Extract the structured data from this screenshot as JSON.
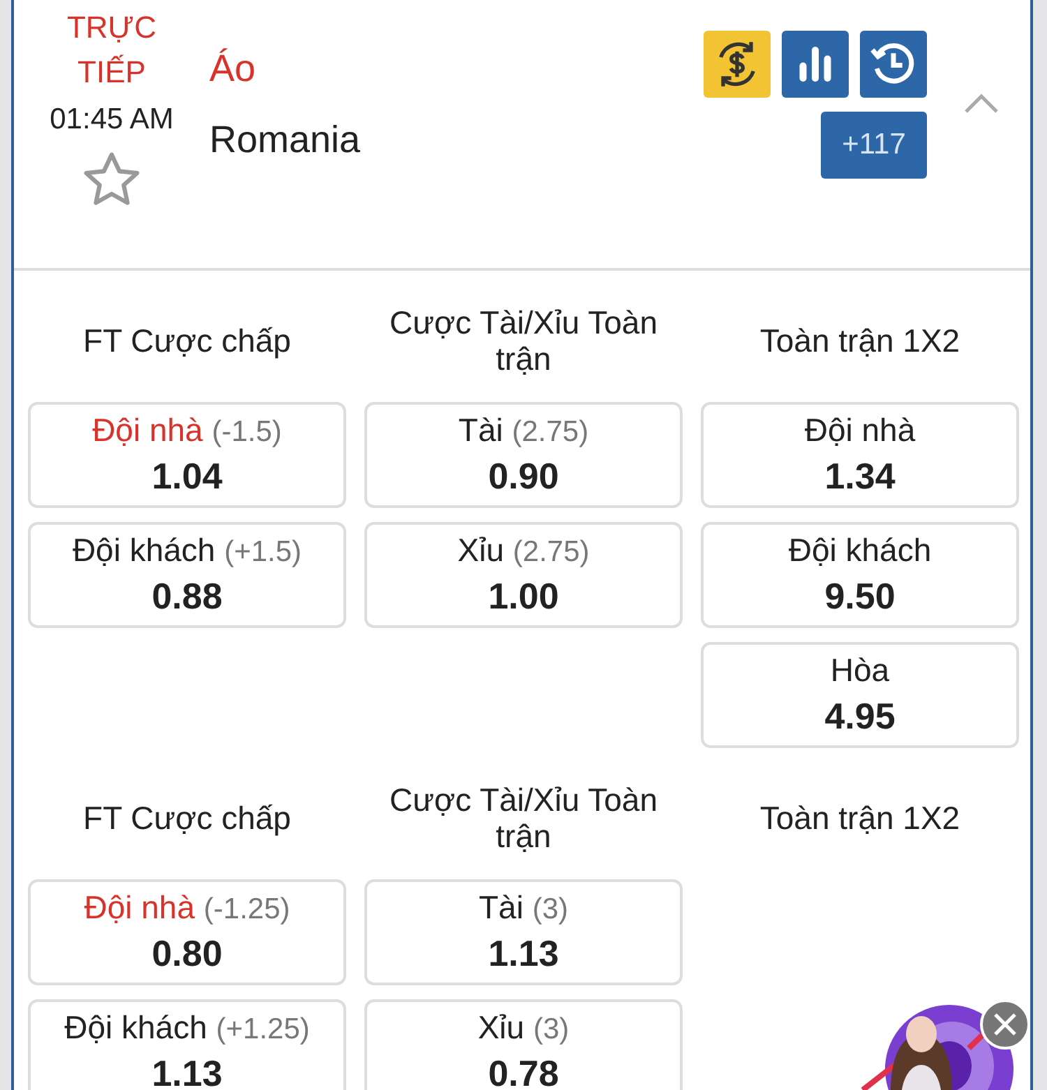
{
  "match": {
    "status": "TRỰC TIẾP",
    "time": "01:45 AM",
    "favorite": false,
    "home_team": "Áo",
    "away_team": "Romania",
    "more_markets": "+117",
    "expanded": true
  },
  "markets": [
    {
      "columns": [
        {
          "title": "FT Cược chấp",
          "cells": [
            {
              "label": "Đội nhà",
              "line": "(-1.5)",
              "odds": "1.04",
              "highlighted": true
            },
            {
              "label": "Đội khách",
              "line": "(+1.5)",
              "odds": "0.88",
              "highlighted": false
            }
          ]
        },
        {
          "title": "Cược Tài/Xỉu Toàn trận",
          "cells": [
            {
              "label": "Tài",
              "line": "(2.75)",
              "odds": "0.90",
              "highlighted": false
            },
            {
              "label": "Xỉu",
              "line": "(2.75)",
              "odds": "1.00",
              "highlighted": false
            }
          ]
        },
        {
          "title": "Toàn trận 1X2",
          "cells": [
            {
              "label": "Đội nhà",
              "odds": "1.34",
              "highlighted": false
            },
            {
              "label": "Đội khách",
              "odds": "9.50",
              "highlighted": false
            },
            {
              "label": "Hòa",
              "odds": "4.95",
              "highlighted": false
            }
          ]
        }
      ]
    },
    {
      "columns": [
        {
          "title": "FT Cược chấp",
          "cells": [
            {
              "label": "Đội nhà",
              "line": "(-1.25)",
              "odds": "0.80",
              "highlighted": true
            },
            {
              "label": "Đội khách",
              "line": "(+1.25)",
              "odds": "1.13",
              "highlighted": false
            }
          ]
        },
        {
          "title": "Cược Tài/Xỉu Toàn trận",
          "cells": [
            {
              "label": "Tài",
              "line": "(3)",
              "odds": "1.13",
              "highlighted": false
            },
            {
              "label": "Xỉu",
              "line": "(3)",
              "odds": "0.78",
              "highlighted": false
            }
          ]
        },
        {
          "title": "Toàn trận 1X2"
        }
      ]
    }
  ]
}
